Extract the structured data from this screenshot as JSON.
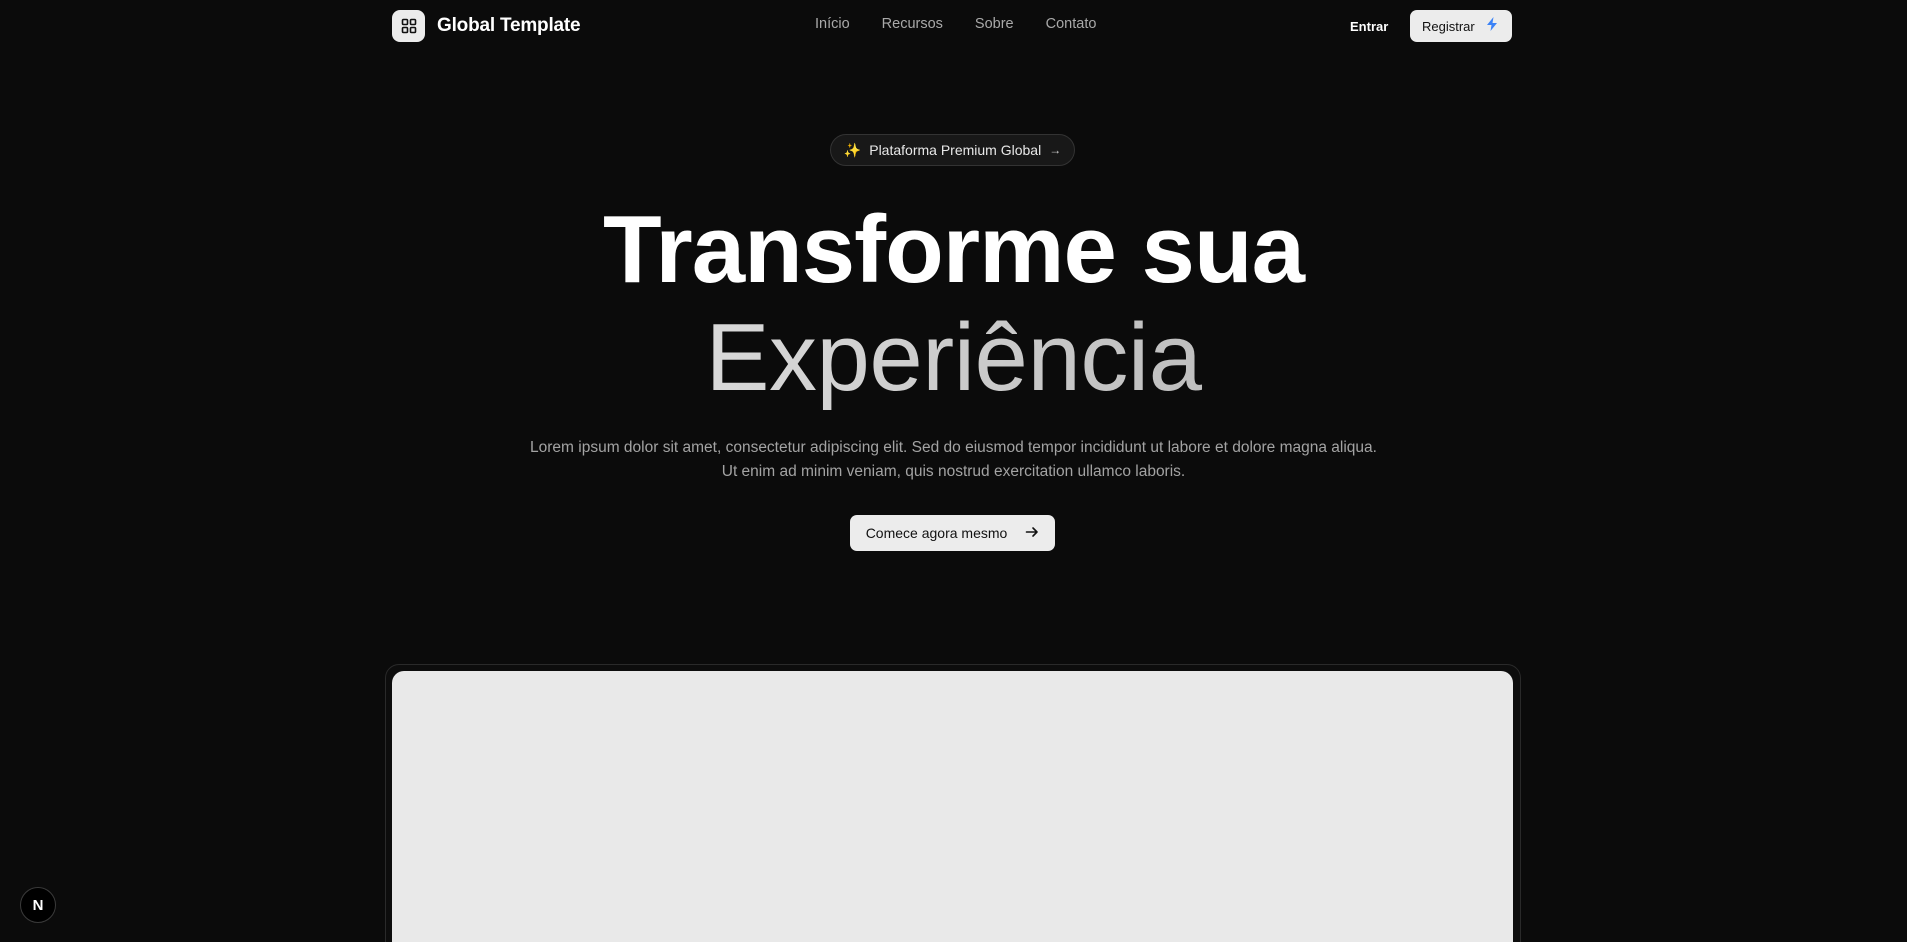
{
  "navbar": {
    "brand_name": "Global Template",
    "brand_icon": "grid-icon",
    "links": [
      "Início",
      "Recursos",
      "Sobre",
      "Contato"
    ],
    "login_label": "Entrar",
    "register_label": "Registrar",
    "register_icon": "lightning-icon"
  },
  "hero": {
    "badge_emoji": "✨",
    "badge_text": "Plataforma Premium Global",
    "badge_arrow": "→",
    "title_line1": "Transforme sua",
    "title_line2": "Experiência",
    "subtitle_line1": "Lorem ipsum dolor sit amet, consectetur adipiscing elit. Sed do eiusmod tempor incididunt ut labore et dolore magna aliqua.",
    "subtitle_line2": "Ut enim ad minim veniam, quis nostrud exercitation ullamco laboris.",
    "cta_label": "Comece agora mesmo",
    "cta_icon": "arrow-right-icon"
  },
  "dev_badge": {
    "label": "N"
  },
  "colors": {
    "background": "#0b0b0b",
    "button_bg": "#ececec",
    "accent_blue": "#3b82f6",
    "muted_text": "#a3a3a3"
  }
}
